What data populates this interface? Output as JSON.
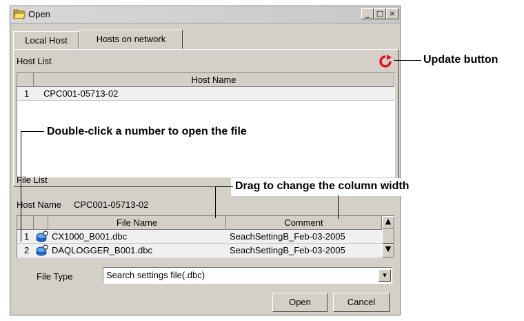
{
  "window": {
    "title": "Open",
    "min_glyph": "_",
    "max_glyph": "□",
    "close_glyph": "×"
  },
  "tabs": [
    {
      "label": "Local Host"
    },
    {
      "label": "Hosts on network"
    }
  ],
  "host_list": {
    "label": "Host List",
    "column_header": "Host Name",
    "rows": [
      {
        "num": "1",
        "name": "CPC001-05713-02"
      }
    ]
  },
  "file_list": {
    "label": "File List",
    "host_name_label": "Host Name",
    "host_name_value": "CPC001-05713-02",
    "columns": {
      "file_name": "File Name",
      "comment": "Comment"
    },
    "rows": [
      {
        "num": "1",
        "file": "CX1000_B001.dbc",
        "comment": "SeachSettingB_Feb-03-2005"
      },
      {
        "num": "2",
        "file": "DAQLOGGER_B001.dbc",
        "comment": "SeachSettingB_Feb-03-2005"
      }
    ]
  },
  "file_type": {
    "label": "File Type",
    "value": "Search settings file(.dbc)"
  },
  "buttons": {
    "open": "Open",
    "cancel": "Cancel"
  },
  "annotations": {
    "update": "Update button",
    "double_click": "Double-click a number to open the file",
    "drag": "Drag to change the column width"
  },
  "colors": {
    "update_icon": "#e0101a",
    "file_icon": "#1e6fd0"
  }
}
